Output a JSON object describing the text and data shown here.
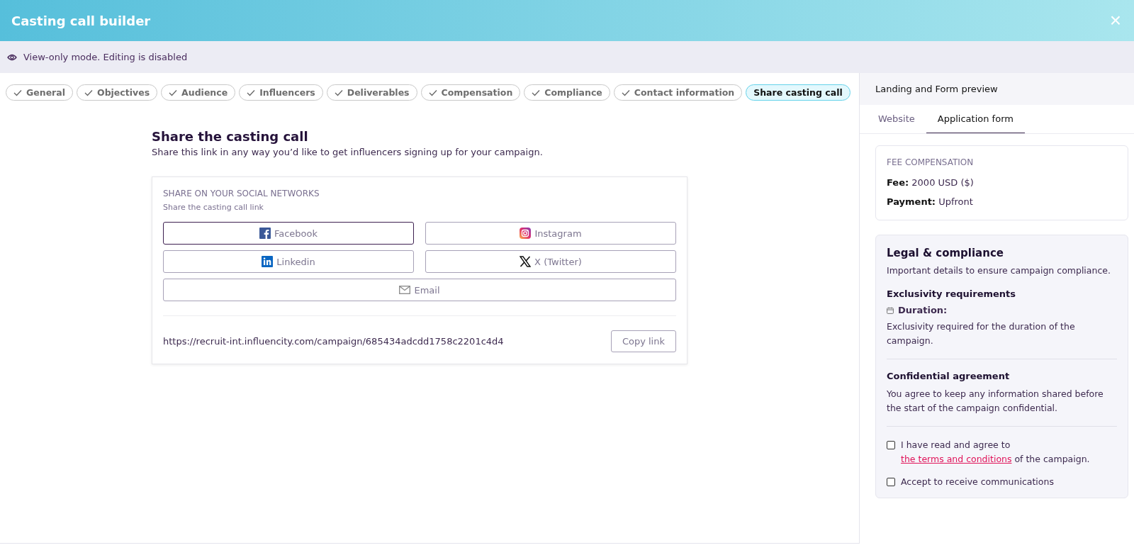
{
  "window": {
    "title": "Casting call builder",
    "close": "×"
  },
  "banner": {
    "text": "View-only mode. Editing is disabled"
  },
  "steps": [
    {
      "label": "General",
      "done": true,
      "selected": false
    },
    {
      "label": "Objectives",
      "done": true,
      "selected": false
    },
    {
      "label": "Audience",
      "done": true,
      "selected": false
    },
    {
      "label": "Influencers",
      "done": true,
      "selected": false
    },
    {
      "label": "Deliverables",
      "done": true,
      "selected": false
    },
    {
      "label": "Compensation",
      "done": true,
      "selected": false
    },
    {
      "label": "Compliance",
      "done": true,
      "selected": false
    },
    {
      "label": "Contact information",
      "done": true,
      "selected": false
    },
    {
      "label": "Share casting call",
      "done": false,
      "selected": true
    }
  ],
  "share": {
    "title": "Share the casting call",
    "subtitle": "Share this link in any way you’d like to get influencers signing up for your campaign.",
    "card": {
      "heading": "SHARE ON YOUR SOCIAL NETWORKS",
      "subheading": "Share the casting call link",
      "buttons": [
        {
          "kind": "facebook",
          "label": "Facebook",
          "focused": true
        },
        {
          "kind": "instagram",
          "label": "Instagram",
          "focused": false
        },
        {
          "kind": "linkedin",
          "label": "Linkedin",
          "focused": false
        },
        {
          "kind": "x",
          "label": "X (Twitter)",
          "focused": false
        },
        {
          "kind": "email",
          "label": "Email",
          "focused": false
        }
      ],
      "link": "https://recruit-int.influencity.com/campaign/685434adcdd1758c2201c4d4",
      "copy_button": "Copy link"
    }
  },
  "preview": {
    "title": "Landing and Form preview",
    "tabs": [
      {
        "label": "Website",
        "selected": false
      },
      {
        "label": "Application form",
        "selected": true
      }
    ],
    "fee": {
      "heading": "FEE COMPENSATION",
      "rows": [
        {
          "label": "Fee:",
          "value": "2000 USD ($)"
        },
        {
          "label": "Payment:",
          "value": "Upfront"
        }
      ]
    },
    "legal": {
      "title": "Legal & compliance",
      "subtitle": "Important details to ensure campaign compliance.",
      "exclusivity": {
        "title": "Exclusivity requirements",
        "label": "Duration:",
        "text": "Exclusivity required for the duration of the campaign."
      },
      "confidential": {
        "title": "Confidential agreement",
        "text": "You agree to keep any information shared before the start of the campaign confidential."
      },
      "checkboxes": [
        {
          "before": "I have read and agree to ",
          "link": "the terms and conditions",
          "after": " of the campaign.",
          "checked": false
        },
        {
          "before": "Accept to receive communications",
          "checked": false
        }
      ]
    }
  }
}
